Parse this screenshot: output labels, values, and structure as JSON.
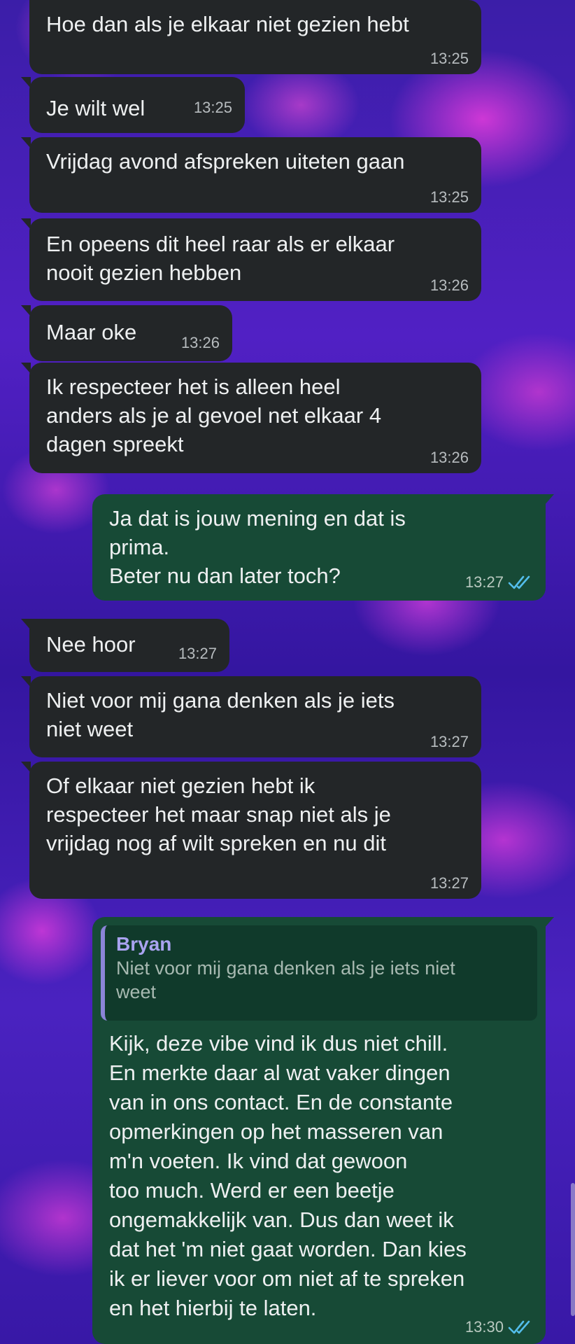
{
  "messages": [
    {
      "dir": "in",
      "text": "Hoe dan als je elkaar niet gezien hebt",
      "time": "13:25"
    },
    {
      "dir": "in",
      "text": "Je wilt wel",
      "time": "13:25"
    },
    {
      "dir": "in",
      "text": "Vrijdag avond afspreken uiteten gaan",
      "time": "13:25"
    },
    {
      "dir": "in",
      "text": "En opeens dit heel raar als er elkaar\nnooit gezien hebben",
      "time": "13:26"
    },
    {
      "dir": "in",
      "text": "Maar oke",
      "time": "13:26"
    },
    {
      "dir": "in",
      "text": "Ik respecteer het is alleen heel\nanders als je al gevoel net elkaar 4\ndagen spreekt",
      "time": "13:26"
    },
    {
      "dir": "out",
      "text": "Ja dat is jouw mening en dat is\nprima.\nBeter nu dan later toch?",
      "time": "13:27",
      "status": "read"
    },
    {
      "dir": "in",
      "text": "Nee hoor",
      "time": "13:27"
    },
    {
      "dir": "in",
      "text": "Niet voor mij gana denken als je iets\nniet weet",
      "time": "13:27"
    },
    {
      "dir": "in",
      "text": "Of elkaar niet gezien hebt ik\nrespecteer het maar snap niet als je\nvrijdag nog af wilt spreken en nu dit",
      "time": "13:27"
    },
    {
      "dir": "out",
      "quote": {
        "author": "Bryan",
        "text": "Niet voor mij gana denken als je iets niet\nweet"
      },
      "text": "Kijk, deze vibe vind ik dus niet chill.\nEn merkte daar al wat vaker dingen\nvan in ons contact. En de constante\nopmerkingen op het masseren van\nm'n voeten. Ik vind dat gewoon\ntoo much. Werd er een beetje\nongemakkelijk van. Dus dan weet ik\ndat het 'm niet gaat worden. Dan kies\nik er liever voor om niet af te spreken\nen het hierbij te laten.",
      "time": "13:30",
      "status": "read"
    }
  ],
  "colors": {
    "incoming": "#232628",
    "outgoing": "#174a36",
    "read_ticks": "#53bdeb",
    "quote_bar": "#8b84d8"
  },
  "icons": {
    "read_status": "double-check-icon"
  }
}
